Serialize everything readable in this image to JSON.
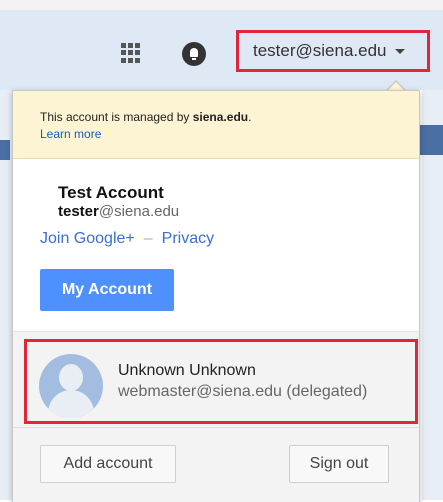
{
  "header": {
    "account_email": "tester@siena.edu",
    "apps_icon": "apps-grid-icon",
    "notifications_icon": "bell-icon"
  },
  "popup": {
    "managed_prefix": "This account is managed by ",
    "managed_domain": "siena.edu",
    "managed_suffix": ".",
    "learn_more": "Learn more",
    "account_name": "Test Account",
    "account_user": "tester",
    "account_domain": "@siena.edu",
    "join_link": "Join Google+",
    "separator": "–",
    "privacy_link": "Privacy",
    "my_account_button": "My Account",
    "delegated": {
      "name": "Unknown Unknown",
      "email": "webmaster@siena.edu (delegated)"
    },
    "add_account_button": "Add account",
    "sign_out_button": "Sign out"
  },
  "colors": {
    "highlight_red": "#e0263a",
    "primary_blue": "#4d90fe",
    "notice_yellow": "#fcf4d2"
  }
}
